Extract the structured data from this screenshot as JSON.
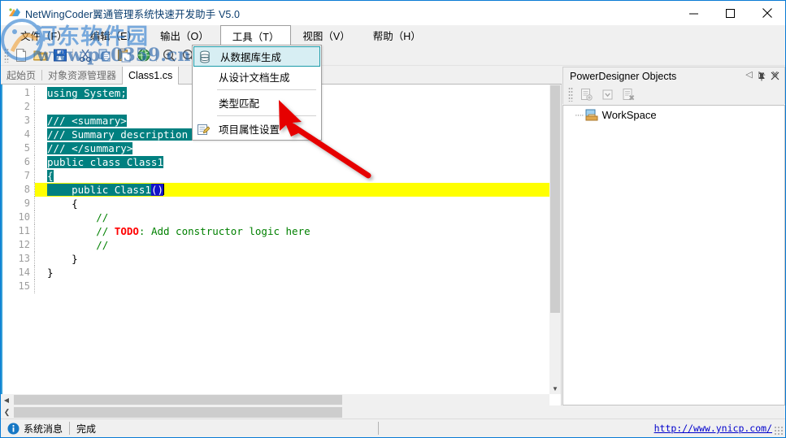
{
  "window": {
    "title": "NetWingCoder翼通管理系统快速开发助手 V5.0",
    "icon": "app-logo-icon",
    "minimize": "–",
    "maximize": "□",
    "close": "✕"
  },
  "menubar": {
    "items": [
      {
        "label": "文件（F）",
        "open": false
      },
      {
        "label": "编辑（E）",
        "open": false
      },
      {
        "label": "输出（O）",
        "open": false
      },
      {
        "label": "工具（T）",
        "open": true
      },
      {
        "label": "视图（V）",
        "open": false
      },
      {
        "label": "帮助（H）",
        "open": false
      }
    ]
  },
  "dropdown": {
    "items": [
      {
        "label": "从数据库生成",
        "icon": "database-icon",
        "selected": true,
        "separator_after": false
      },
      {
        "label": "从设计文档生成",
        "icon": "",
        "selected": false,
        "separator_after": true
      },
      {
        "label": "类型匹配",
        "icon": "",
        "selected": false,
        "separator_after": true
      },
      {
        "label": "项目属性设置",
        "icon": "properties-icon",
        "selected": false,
        "separator_after": false
      }
    ]
  },
  "toolbar": {
    "buttons": [
      {
        "name": "new-file-icon",
        "title": "新建"
      },
      {
        "name": "open-folder-icon",
        "title": "打开"
      },
      {
        "name": "save-icon",
        "title": "保存"
      },
      {
        "name": "cut-icon",
        "title": "剪切"
      },
      {
        "name": "copy-icon",
        "title": "复制"
      },
      {
        "name": "paste-icon",
        "title": "粘贴"
      },
      {
        "name": "globe-icon",
        "title": "浏览"
      },
      {
        "name": "zoom-in-icon",
        "title": "放大"
      },
      {
        "name": "zoom-out-icon",
        "title": "缩小"
      }
    ]
  },
  "tabs": {
    "items": [
      {
        "label": "起始页",
        "active": false
      },
      {
        "label": "对象资源管理器",
        "active": false
      },
      {
        "label": "Class1.cs",
        "active": true
      }
    ],
    "nav_prev": "◁",
    "nav_next": "▷",
    "nav_close": "✕"
  },
  "editor": {
    "lines": [
      {
        "n": "1",
        "segments": [
          {
            "t": "using System;",
            "cls": "sel"
          }
        ],
        "highlight": false
      },
      {
        "n": "2",
        "segments": [
          {
            "t": "",
            "cls": "sel"
          }
        ],
        "highlight": false
      },
      {
        "n": "3",
        "segments": [
          {
            "t": "/// <summary>",
            "cls": "sel"
          }
        ],
        "highlight": false
      },
      {
        "n": "4",
        "segments": [
          {
            "t": "/// Summary description for Class1",
            "cls": "sel"
          }
        ],
        "highlight": false
      },
      {
        "n": "5",
        "segments": [
          {
            "t": "/// </summary>",
            "cls": "sel"
          }
        ],
        "highlight": false
      },
      {
        "n": "6",
        "segments": [
          {
            "t": "public class Class1",
            "cls": "sel"
          }
        ],
        "highlight": false
      },
      {
        "n": "7",
        "segments": [
          {
            "t": "{",
            "cls": "sel"
          }
        ],
        "highlight": false
      },
      {
        "n": "8",
        "segments": [
          {
            "t": "    public Class1",
            "cls": "sel"
          },
          {
            "t": "()",
            "cls": "paren-hl"
          }
        ],
        "highlight": true
      },
      {
        "n": "9",
        "segments": [
          {
            "t": "    {",
            "cls": "plain"
          }
        ],
        "highlight": false
      },
      {
        "n": "10",
        "segments": [
          {
            "t": "        //",
            "cls": "cmt"
          }
        ],
        "highlight": false
      },
      {
        "n": "11",
        "segments": [
          {
            "t": "        // ",
            "cls": "cmt"
          },
          {
            "t": "TODO",
            "cls": "todo"
          },
          {
            "t": ": Add constructor logic here",
            "cls": "cmt"
          }
        ],
        "highlight": false
      },
      {
        "n": "12",
        "segments": [
          {
            "t": "        //",
            "cls": "cmt"
          }
        ],
        "highlight": false
      },
      {
        "n": "13",
        "segments": [
          {
            "t": "    }",
            "cls": "plain"
          }
        ],
        "highlight": false
      },
      {
        "n": "14",
        "segments": [
          {
            "t": "}",
            "cls": "plain"
          }
        ],
        "highlight": false
      },
      {
        "n": "15",
        "segments": [
          {
            "t": "",
            "cls": "plain"
          }
        ],
        "highlight": false
      }
    ]
  },
  "dock": {
    "title": "PowerDesigner Objects",
    "pin": "📌",
    "close": "✕",
    "toolbar_buttons": [
      {
        "name": "add-object-icon",
        "enabled": false
      },
      {
        "name": "dropdown-arrow-icon",
        "enabled": false
      },
      {
        "name": "delete-object-icon",
        "enabled": false
      }
    ],
    "tree": [
      {
        "label": "WorkSpace",
        "icon": "workspace-icon"
      }
    ]
  },
  "statusbar": {
    "info_icon": "info-icon",
    "message_label": "系统消息",
    "message_value": "完成",
    "link": "http://www.ynicp.com/"
  },
  "watermark": {
    "line1": "河东软件园",
    "line2": "www.pc0359.cn"
  },
  "colors": {
    "accent": "#0a7bd4",
    "selection": "#008080",
    "current_line": "#ffff00",
    "comment": "#008000",
    "todo": "#ff0000",
    "link": "#0000cc",
    "menu_highlight": "#d7eef3",
    "annotation_arrow": "#e60000"
  }
}
